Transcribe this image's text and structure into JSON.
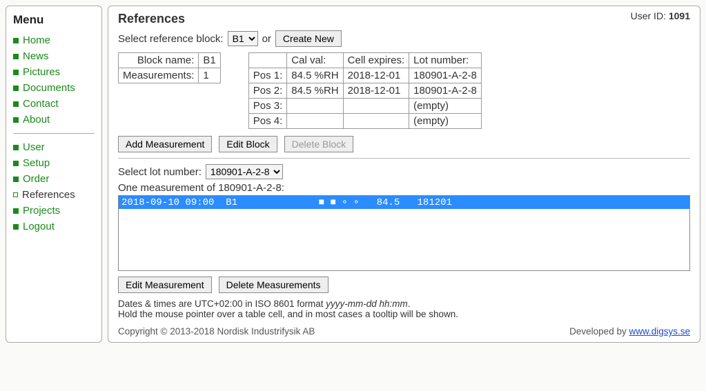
{
  "sidebar": {
    "title": "Menu",
    "group1": [
      {
        "label": "Home"
      },
      {
        "label": "News"
      },
      {
        "label": "Pictures"
      },
      {
        "label": "Documents"
      },
      {
        "label": "Contact"
      },
      {
        "label": "About"
      }
    ],
    "group2": [
      {
        "label": "User"
      },
      {
        "label": "Setup"
      },
      {
        "label": "Order"
      },
      {
        "label": "References",
        "current": true
      },
      {
        "label": "Projects"
      },
      {
        "label": "Logout"
      }
    ]
  },
  "user_id_label": "User ID: ",
  "user_id": "1091",
  "page_title": "References",
  "select_block": {
    "label": "Select reference block:",
    "selected": "B1",
    "or": "or",
    "create_new": "Create New"
  },
  "block_table": {
    "name_label": "Block name:",
    "name_value": "B1",
    "meas_label": "Measurements:",
    "meas_value": "1"
  },
  "pos_table": {
    "h_cal": "Cal val:",
    "h_exp": "Cell expires:",
    "h_lot": "Lot number:",
    "rows": [
      {
        "pos": "Pos 1:",
        "cal": "84.5 %RH",
        "exp": "2018-12-01",
        "lot": "180901-A-2-8"
      },
      {
        "pos": "Pos 2:",
        "cal": "84.5 %RH",
        "exp": "2018-12-01",
        "lot": "180901-A-2-8"
      },
      {
        "pos": "Pos 3:",
        "cal": "",
        "exp": "",
        "lot": "(empty)"
      },
      {
        "pos": "Pos 4:",
        "cal": "",
        "exp": "",
        "lot": "(empty)"
      }
    ]
  },
  "buttons": {
    "add_meas": "Add Measurement",
    "edit_block": "Edit Block",
    "delete_block": "Delete Block",
    "edit_meas": "Edit Measurement",
    "delete_meas": "Delete Measurements"
  },
  "select_lot": {
    "label": "Select lot number:",
    "selected": "180901-A-2-8"
  },
  "measurements": {
    "heading": "One measurement of 180901-A-2-8:",
    "rows": [
      {
        "text": "2018-09-10 09:00  B1              ■ ■ ∘ ∘   84.5   181201",
        "selected": true
      }
    ]
  },
  "hint_line1_a": "Dates & times are UTC+02:00 in ISO 8601 format ",
  "hint_line1_b": "yyyy-mm-dd hh:mm",
  "hint_line1_c": ".",
  "hint_line2": "Hold the mouse pointer over a table cell, and in most cases a tooltip will be shown.",
  "footer": {
    "copyright": "Copyright © 2013-2018 Nordisk Industrifysik AB",
    "dev_label": "Developed by ",
    "dev_link": "www.digsys.se"
  }
}
